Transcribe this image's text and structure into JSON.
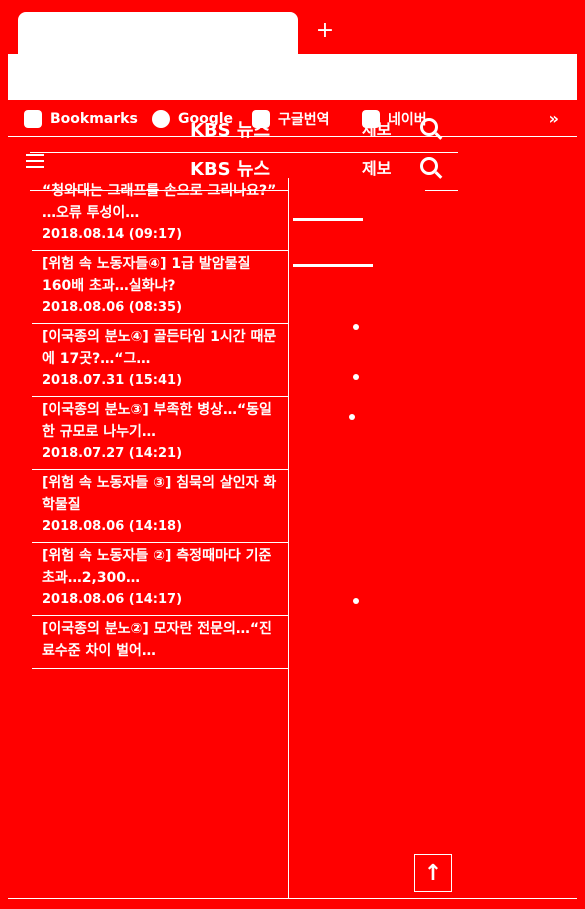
{
  "browser": {
    "new_tab_label": "+",
    "bookmarks": [
      {
        "label": "Bookmarks",
        "icon": "star-icon"
      },
      {
        "label": "Google",
        "icon": "google-icon"
      },
      {
        "label": "구글번역",
        "icon": "folder-icon"
      },
      {
        "label": "네이버",
        "icon": "naver-icon"
      }
    ],
    "more_label": "»"
  },
  "site": {
    "brand": "KBS 뉴스",
    "report_label": "제보"
  },
  "news": [
    {
      "title": "“청와대는 그래프를 손으로 그리나요?” …오류 투성이…",
      "date": "2018.08.14 (09:17)"
    },
    {
      "title": "[위험 속 노동자들④] 1급 발암물질 160배 초과…실화냐?",
      "date": "2018.08.06 (08:35)"
    },
    {
      "title": "[이국종의 분노④] 골든타임 1시간 때문에 17곳?…“그…",
      "date": "2018.07.31 (15:41)"
    },
    {
      "title": "[이국종의 분노③] 부족한 병상…“동일한 규모로 나누기…",
      "date": "2018.07.27 (14:21)"
    },
    {
      "title": "[위험 속 노동자들 ③] 침묵의 살인자 화학물질",
      "date": "2018.08.06 (14:18)"
    },
    {
      "title": "[위험 속 노동자들 ②] 측정때마다 기준 초과…2,300…",
      "date": "2018.08.06 (14:17)"
    },
    {
      "title": "[이국종의 분노②] 모자란 전문의…“진료수준 차이 벌어…",
      "date": ""
    }
  ],
  "scroll_top_label": "↑"
}
